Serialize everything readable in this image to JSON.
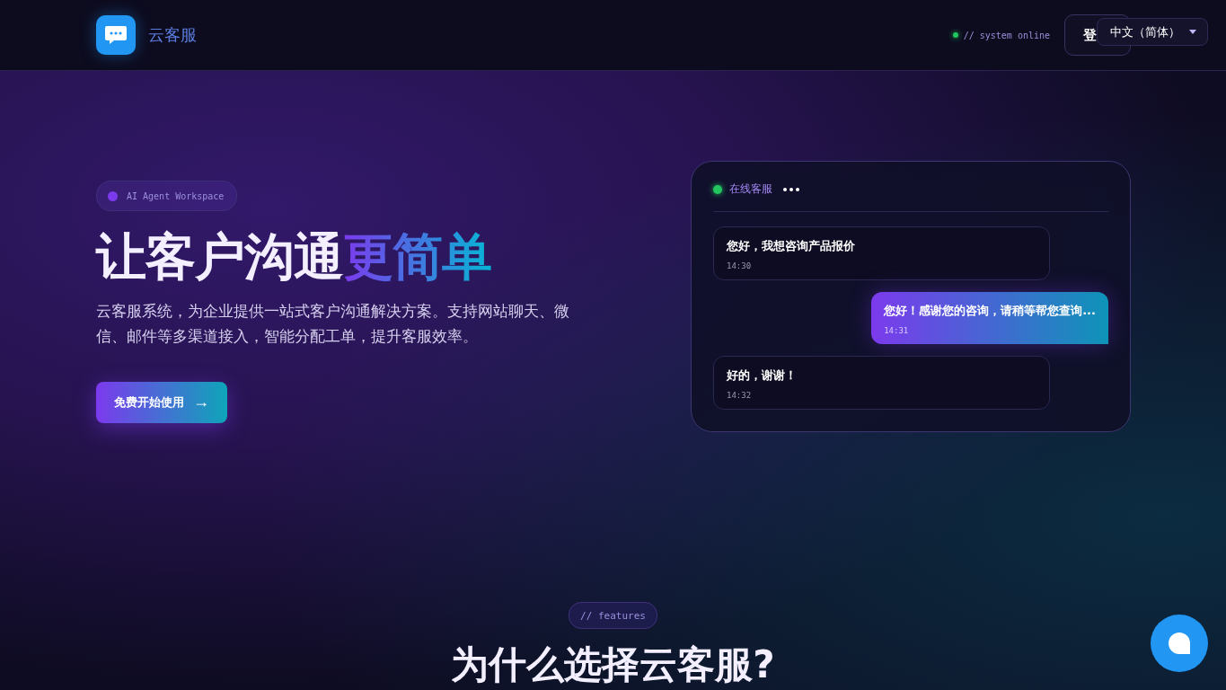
{
  "header": {
    "brand": "云客服",
    "status": "// system online",
    "login_button": "登",
    "language": {
      "value": "中文（简体）"
    }
  },
  "hero": {
    "badge": "AI Agent Workspace",
    "title_plain": "让客户沟通",
    "title_highlight": "更简单",
    "description": "云客服系统，为企业提供一站式客户沟通解决方案。支持网站聊天、微信、邮件等多渠道接入，智能分配工单，提升客服效率。",
    "cta": "免费开始使用",
    "cta_arrow": "→"
  },
  "chat_preview": {
    "agent": "在线客服",
    "online": true,
    "messages": [
      {
        "kind": "incoming",
        "text": "您好，我想咨询产品报价",
        "time": "14:30"
      },
      {
        "kind": "outgoing",
        "text": "您好！感谢您的咨询，请稍等帮您查询...",
        "time": "14:31"
      },
      {
        "kind": "incoming",
        "text": "好的，谢谢！",
        "time": "14:32"
      }
    ]
  },
  "features": {
    "tag": "// features",
    "title": "为什么选择云客服?"
  }
}
